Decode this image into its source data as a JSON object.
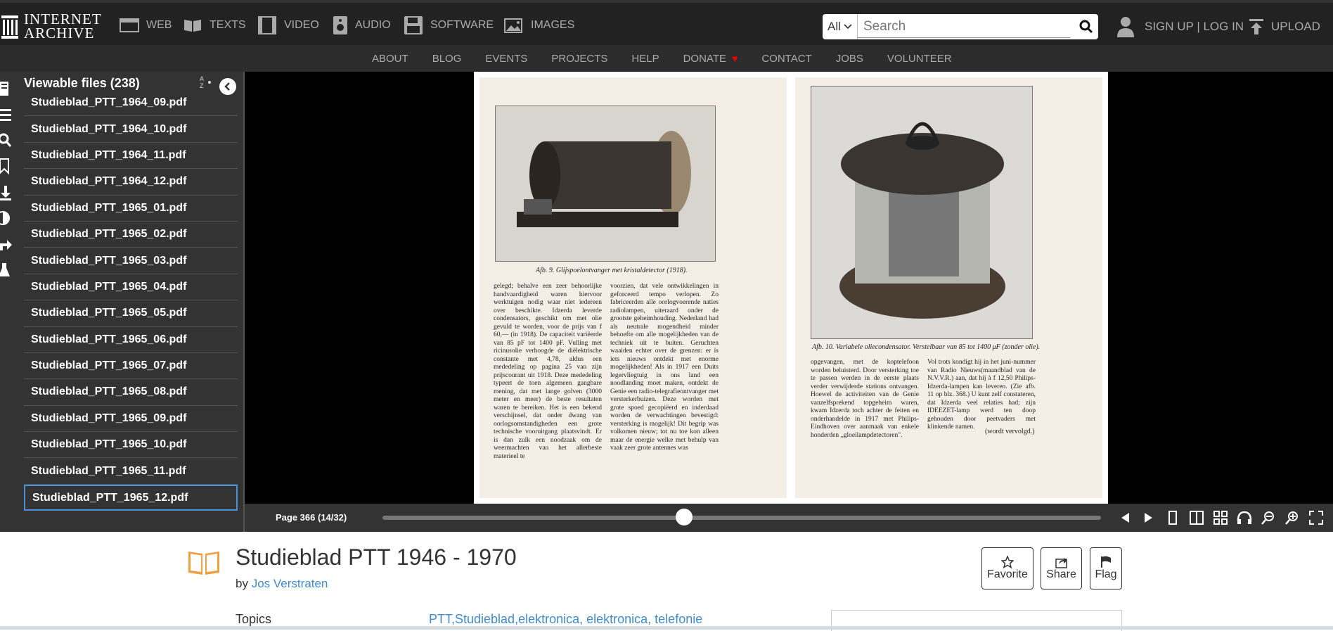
{
  "header": {
    "logo_line1": "INTERNET",
    "logo_line2": "ARCHIVE",
    "nav": [
      "WEB",
      "TEXTS",
      "VIDEO",
      "AUDIO",
      "SOFTWARE",
      "IMAGES"
    ],
    "search_scope": "All",
    "search_placeholder": "Search",
    "signup": "SIGN UP | LOG IN",
    "upload": "UPLOAD"
  },
  "subnav": [
    "ABOUT",
    "BLOG",
    "EVENTS",
    "PROJECTS",
    "HELP",
    "DONATE",
    "CONTACT",
    "JOBS",
    "VOLUNTEER"
  ],
  "panel": {
    "title": "Viewable files (238)",
    "sort_label": "A Z",
    "files": [
      "Studieblad_PTT_1964_09.pdf",
      "Studieblad_PTT_1964_10.pdf",
      "Studieblad_PTT_1964_11.pdf",
      "Studieblad_PTT_1964_12.pdf",
      "Studieblad_PTT_1965_01.pdf",
      "Studieblad_PTT_1965_02.pdf",
      "Studieblad_PTT_1965_03.pdf",
      "Studieblad_PTT_1965_04.pdf",
      "Studieblad_PTT_1965_05.pdf",
      "Studieblad_PTT_1965_06.pdf",
      "Studieblad_PTT_1965_07.pdf",
      "Studieblad_PTT_1965_08.pdf",
      "Studieblad_PTT_1965_09.pdf",
      "Studieblad_PTT_1965_10.pdf",
      "Studieblad_PTT_1965_11.pdf",
      "Studieblad_PTT_1965_12.pdf"
    ]
  },
  "book": {
    "left_caption": "Afb. 9. Glijspoelontvanger met kristaldetector (1918).",
    "left_col1": "gelegd; behalve een zeer behoorlijke handvaardigheid waren hiervoor werktuigen nodig waar niet iedereen over beschikte. Idzerda leverde condensators, geschikt om met olie gevuld te worden, voor de prijs van f 60,— (in 1918). De capaciteit variëerde van 85 pF tot 1400 pF. Vulling met ricinusolie verhoogde de diëlektrische constante met 4,78, aldus een mededeling op pagina 25 van zijn prijscourant uit 1918. Deze mededeling typeert de toen algemeen gangbare mening, dat met lange golven (3000 meter en meer) de beste resultaten waren te bereiken. Het is een bekend verschijnsel, dat onder dwang van oorlogsomstandigheden een grote technische vooruitgang plaatsvindt. Er is dan zulk een noodzaak om de weermachten van het allerbeste materieel te",
    "left_col2": "voorzien, dat vele ontwikkelingen in geforceerd tempo verlopen. Zo fabriceerden alle oorlogvoerende naties radiolampen, uiteraard onder de grootste geheimhouding. Nederland had als neutrale mogendheid minder behoefte om alle mogelijkheden van de techniek uit te buiten. Geruchten waaiden echter over de grenzen: er is iets nieuws ontdekt met enorme mogelijkheden! Als in 1917 een Duits legervliegtuig in ons land een noodlanding moet maken, ontdekt de Genie een radio-telegrafieontvanger met versterkerbuizen. Deze worden met grote spoed gecopiëerd en inderdaad worden de verwachtingen bevestigd: versterking is mogelijk! Dit begrip was volkomen nieuw; tot nu toe kon alleen maar de energie welke met behulp van vaak zeer grote antennes was",
    "right_caption": "Afb. 10. Variabele oliecondensator. Verstelbaar van 85 tot 1400 μF (zonder olie).",
    "right_col1": "opgevangen, met de koptelefoon worden beluisterd. Door versterking toe te passen werden in de eerste plaats verder verwijderde stations ontvangen. Hoewel de activiteiten van de Genie vanzelfsprekend topgeheim waren, kwam Idzerda toch achter de feiten en onderhandelde in 1917 met Philips-Eindhoven over aanmaak van enkele honderden „gloeilampdetectoren\".",
    "right_col2": "Vol trots kondigt hij in het juni-nummer van Radio Nieuws(maandblad van de N.V.V.R.) aan, dat hij à f 12,50 Philips-Idzerda-lampen kan leveren. (Zie afb. 11 op blz. 368.) U kunt zelf constateren, dat Idzerda veel relaties had; zijn IDEEZET-lamp werd ten doop gehouden door peetvaders met klinkende namen.",
    "right_footer": "(wordt vervolgd.)"
  },
  "controls": {
    "page_label": "Page 366 (14/32)",
    "progress": 0.42
  },
  "meta": {
    "title": "Studieblad PTT 1946 - 1970",
    "by": "by",
    "author": "Jos Verstraten",
    "favorite": "Favorite",
    "share": "Share",
    "flag": "Flag",
    "topics_label": "Topics",
    "topics": "PTT,Studieblad,elektronica, elektronica, telefonie"
  },
  "colors": {
    "accent": "#428bca",
    "book_icon": "#f0a040",
    "heart": "#e00000"
  }
}
